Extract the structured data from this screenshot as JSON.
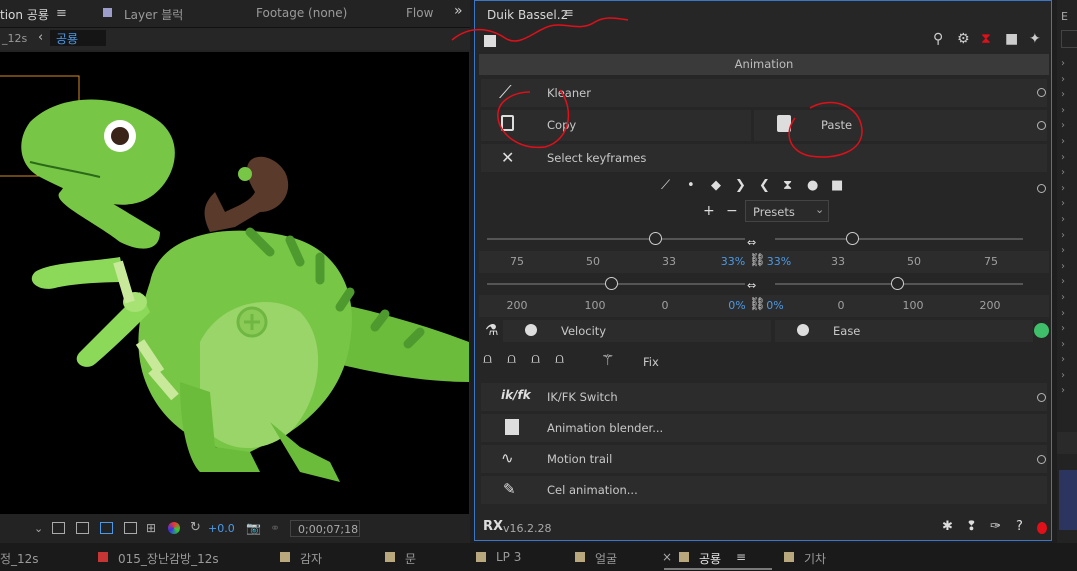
{
  "left_panel": {
    "tabs": {
      "composition": "tion 공룡",
      "layer": "Layer 블럭",
      "footage": "Footage (none)",
      "flow": "Flow"
    },
    "subbar": {
      "time_label": "_12s",
      "breadcrumb": "공룡"
    },
    "bottom": {
      "exposure": "+0.0",
      "timecode": "0;00;07;18"
    }
  },
  "duik": {
    "title": "Duik Bassel.2",
    "section": "Animation",
    "tools": {
      "kleaner": "Kleaner",
      "copy": "Copy",
      "paste": "Paste",
      "select_keyframes": "Select keyframes",
      "presets": "Presets",
      "velocity": "Velocity",
      "ease": "Ease",
      "fix": "Fix",
      "ikfk": "IK/FK Switch",
      "blender": "Animation blender...",
      "motion_trail": "Motion trail",
      "cel": "Cel animation..."
    },
    "slider1": {
      "left": [
        "75",
        "50",
        "33",
        "33%"
      ],
      "right": [
        "33%",
        "33",
        "50",
        "75"
      ]
    },
    "slider2": {
      "left": [
        "200",
        "100",
        "0",
        "0%"
      ],
      "right": [
        "0%",
        "0",
        "100",
        "200"
      ]
    },
    "version": "v16.2.28"
  },
  "bottom_tabs": [
    "정_12s",
    "015_장난감방_12s",
    "감자",
    "문",
    "LP 3",
    "얼굴",
    "공룡",
    "기차"
  ],
  "colors": {
    "accent_blue": "#3a77c9",
    "annotation_red": "#e0101a",
    "dino_green": "#7cc84a",
    "key_brown": "#5a3a2a"
  }
}
